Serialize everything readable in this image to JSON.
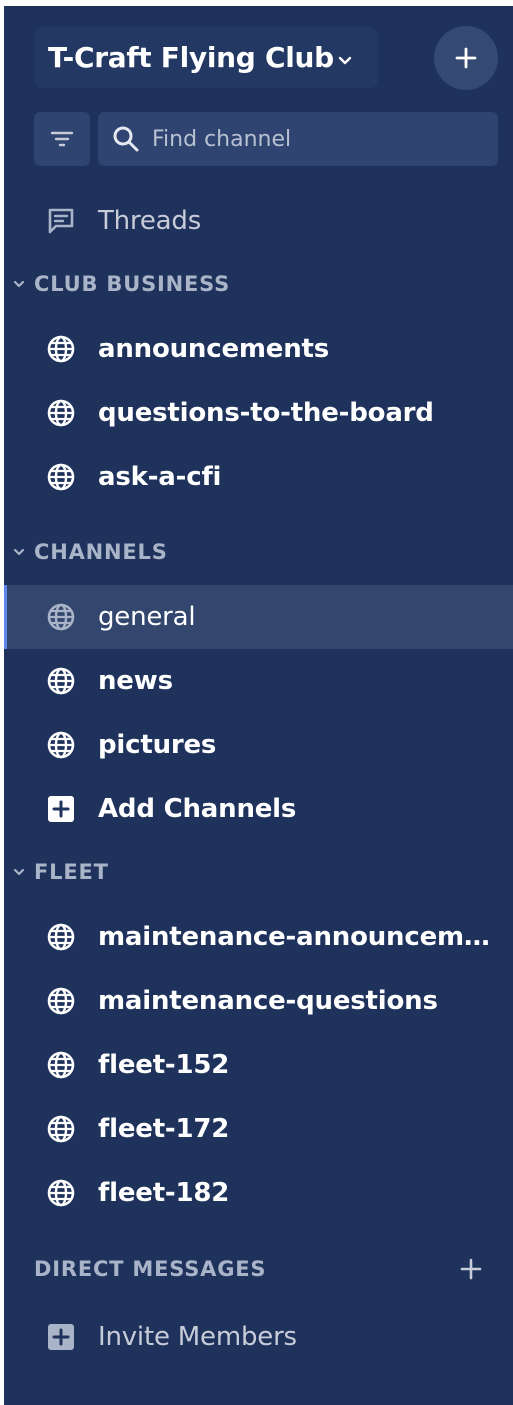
{
  "team": {
    "name": "T-Craft Flying Club",
    "add_button_label": "+"
  },
  "search": {
    "placeholder": "Find channel"
  },
  "threads": {
    "label": "Threads"
  },
  "sections": [
    {
      "title": "CLUB BUSINESS",
      "items": [
        {
          "label": "announcements",
          "icon": "globe-icon"
        },
        {
          "label": "questions-to-the-board",
          "icon": "globe-icon"
        },
        {
          "label": "ask-a-cfi",
          "icon": "globe-icon"
        }
      ]
    },
    {
      "title": "CHANNELS",
      "items": [
        {
          "label": "general",
          "icon": "globe-icon",
          "active": true
        },
        {
          "label": "news",
          "icon": "globe-icon"
        },
        {
          "label": "pictures",
          "icon": "globe-icon"
        },
        {
          "label": "Add Channels",
          "icon": "plus-box-icon"
        }
      ]
    },
    {
      "title": "FLEET",
      "items": [
        {
          "label": "maintenance-announceme...",
          "icon": "globe-icon"
        },
        {
          "label": "maintenance-questions",
          "icon": "globe-icon"
        },
        {
          "label": "fleet-152",
          "icon": "globe-icon"
        },
        {
          "label": "fleet-172",
          "icon": "globe-icon"
        },
        {
          "label": "fleet-182",
          "icon": "globe-icon"
        }
      ]
    }
  ],
  "direct_messages": {
    "title": "DIRECT MESSAGES",
    "invite_label": "Invite Members"
  },
  "colors": {
    "sidebar_bg": "#1e325c",
    "active_row_bg": "#33466e",
    "active_indicator": "#5d89ea",
    "text_bright": "#ffffff",
    "text_muted": "#aab4c8"
  }
}
